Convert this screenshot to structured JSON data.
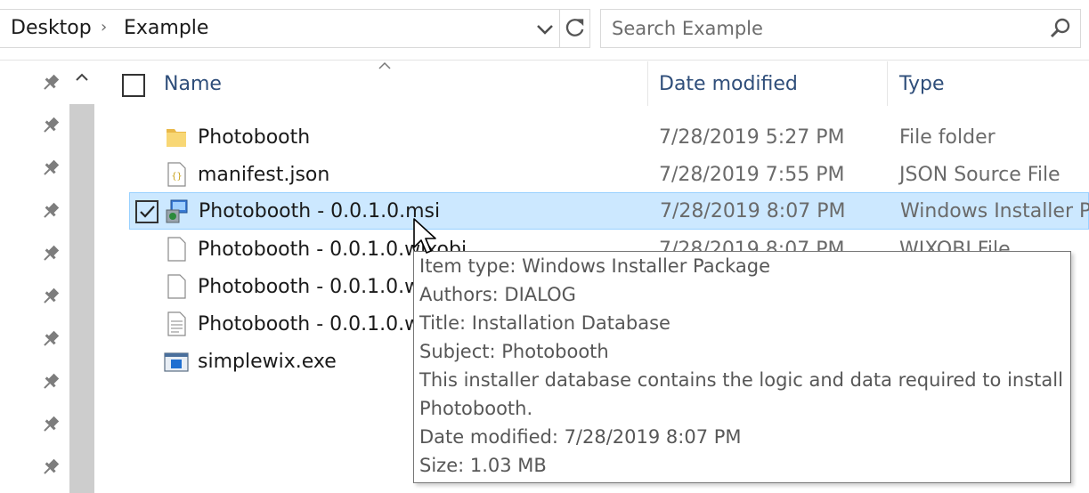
{
  "address_bar": {
    "breadcrumbs": [
      "Desktop",
      "Example"
    ],
    "separator": "›",
    "dropdown_icon": "chevron-down-icon",
    "refresh_icon": "refresh-icon"
  },
  "search": {
    "placeholder": "Search Example",
    "icon": "search-icon"
  },
  "nav_pane": {
    "pinned_icon": "pin-icon",
    "pinned_count": 10
  },
  "columns": {
    "name": "Name",
    "date_modified": "Date modified",
    "type": "Type"
  },
  "files": [
    {
      "name": "Photobooth",
      "date": "7/28/2019 5:27 PM",
      "type": "File folder",
      "icon": "folder-icon",
      "selected": false
    },
    {
      "name": "manifest.json",
      "date": "7/28/2019 7:55 PM",
      "type": "JSON Source File",
      "icon": "json-file-icon",
      "selected": false
    },
    {
      "name": "Photobooth - 0.0.1.0.msi",
      "date": "7/28/2019 8:07 PM",
      "type": "Windows Installer Pa",
      "icon": "msi-installer-icon",
      "selected": true
    },
    {
      "name": "Photobooth - 0.0.1.0.wixobj",
      "date": "7/28/2019 8:07 PM",
      "type": "WIXOBJ File",
      "icon": "blank-file-icon",
      "selected": false
    },
    {
      "name": "Photobooth - 0.0.1.0.w",
      "date": "",
      "type": "",
      "icon": "blank-file-icon",
      "selected": false
    },
    {
      "name": "Photobooth - 0.0.1.0.w",
      "date": "",
      "type": "",
      "icon": "text-file-icon",
      "selected": false
    },
    {
      "name": "simplewix.exe",
      "date": "",
      "type": "",
      "icon": "exe-app-icon",
      "selected": false
    }
  ],
  "tooltip": {
    "lines": [
      "Item type: Windows Installer Package",
      "Authors: DIALOG",
      "Title: Installation Database",
      "Subject: Photobooth",
      "This installer database contains the logic and data required to install",
      "Photobooth.",
      "Date modified: 7/28/2019 8:07 PM",
      "Size: 1.03 MB"
    ]
  },
  "colors": {
    "selection_bg": "#cce8ff",
    "selection_border": "#99d1ff",
    "header_text": "#2f4e7a",
    "folder_yellow": "#f8d775"
  }
}
